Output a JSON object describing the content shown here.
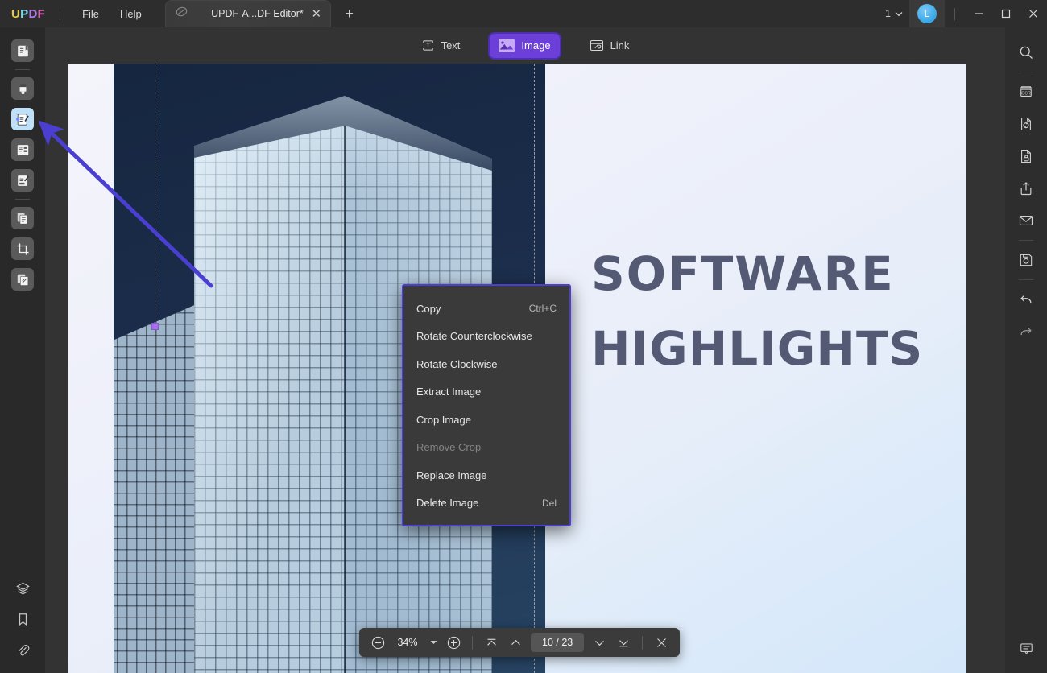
{
  "titlebar": {
    "logo": [
      "U",
      "P",
      "D",
      "F"
    ],
    "menus": [
      {
        "label": "File"
      },
      {
        "label": "Help"
      }
    ],
    "tab": {
      "title": "UPDF-A...DF Editor*",
      "close_label": "✕",
      "icon": "document-icon"
    },
    "new_tab_label": "+",
    "window_pages": "1",
    "window_pages_caret": "∨",
    "avatar_initial": "L",
    "minimize_label": "—",
    "maximize_label": "☐",
    "close_label": "✕"
  },
  "toolbar": {
    "items": [
      {
        "label": "Text",
        "icon": "text-icon",
        "selected": false
      },
      {
        "label": "Image",
        "icon": "image-icon",
        "selected": true
      },
      {
        "label": "Link",
        "icon": "link-icon",
        "selected": false
      }
    ]
  },
  "left_sidebar": {
    "items": [
      {
        "name": "reader-tool",
        "icon": "reader-icon",
        "active": false
      },
      {
        "name": "annotate-tool",
        "icon": "highlighter-icon",
        "active": false
      },
      {
        "name": "edit-pdf-tool",
        "icon": "edit-pdf-icon",
        "active": true
      },
      {
        "name": "page-tool",
        "icon": "organize-pages-icon",
        "active": false
      },
      {
        "name": "form-tool",
        "icon": "prepare-form-icon",
        "active": false
      },
      {
        "name": "convert-tool",
        "icon": "convert-pdf-icon",
        "active": false
      },
      {
        "name": "crop-tool",
        "icon": "crop-page-icon",
        "active": false
      },
      {
        "name": "compress-tool",
        "icon": "batch-icon",
        "active": false
      }
    ],
    "bottom_items": [
      {
        "name": "layers-panel",
        "icon": "layers-icon"
      },
      {
        "name": "bookmarks-panel",
        "icon": "bookmark-icon"
      },
      {
        "name": "attachments-panel",
        "icon": "paperclip-icon"
      }
    ]
  },
  "right_sidebar": {
    "items": [
      {
        "name": "search",
        "icon": "search-icon"
      },
      {
        "name": "ocr",
        "icon": "ocr-icon"
      },
      {
        "name": "convert",
        "icon": "convert-icon"
      },
      {
        "name": "protect",
        "icon": "lock-document-icon"
      },
      {
        "name": "share",
        "icon": "share-icon"
      },
      {
        "name": "email",
        "icon": "email-icon"
      },
      {
        "name": "save",
        "icon": "save-icon"
      },
      {
        "name": "undo",
        "icon": "undo-icon"
      },
      {
        "name": "redo",
        "icon": "redo-icon"
      }
    ],
    "bottom_items": [
      {
        "name": "comment",
        "icon": "comment-icon"
      }
    ]
  },
  "context_menu": {
    "items": [
      {
        "label": "Copy",
        "shortcut": "Ctrl+C",
        "disabled": false
      },
      {
        "label": "Rotate Counterclockwise",
        "shortcut": "",
        "disabled": false
      },
      {
        "label": "Rotate Clockwise",
        "shortcut": "",
        "disabled": false
      },
      {
        "label": "Extract Image",
        "shortcut": "",
        "disabled": false
      },
      {
        "label": "Crop Image",
        "shortcut": "",
        "disabled": false
      },
      {
        "label": "Remove Crop",
        "shortcut": "",
        "disabled": true
      },
      {
        "label": "Replace Image",
        "shortcut": "",
        "disabled": false
      },
      {
        "label": "Delete Image",
        "shortcut": "Del",
        "disabled": false
      }
    ]
  },
  "document": {
    "headline_line1": "SOFTWARE",
    "headline_line2": "HIGHLIGHTS",
    "headline_color": "#545a73",
    "image_alt": "glass-skyscraper-photo"
  },
  "bottom_bar": {
    "zoom_out_label": "⊖",
    "zoom_value": "34%",
    "zoom_caret": "▼",
    "zoom_in_label": "⊕",
    "first_page_label": "first-page",
    "prev_page_label": "previous-page",
    "page_indicator": "10 / 23",
    "current_page": "10",
    "total_pages": "23",
    "next_page_label": "next-page",
    "last_page_label": "last-page",
    "close_label": "✕"
  },
  "accent": {
    "selected_tool": "#6c3fd8",
    "arrow": "#4a3fd0",
    "handle": "#a770e8",
    "active_sidebar": "#bfe0f7"
  }
}
